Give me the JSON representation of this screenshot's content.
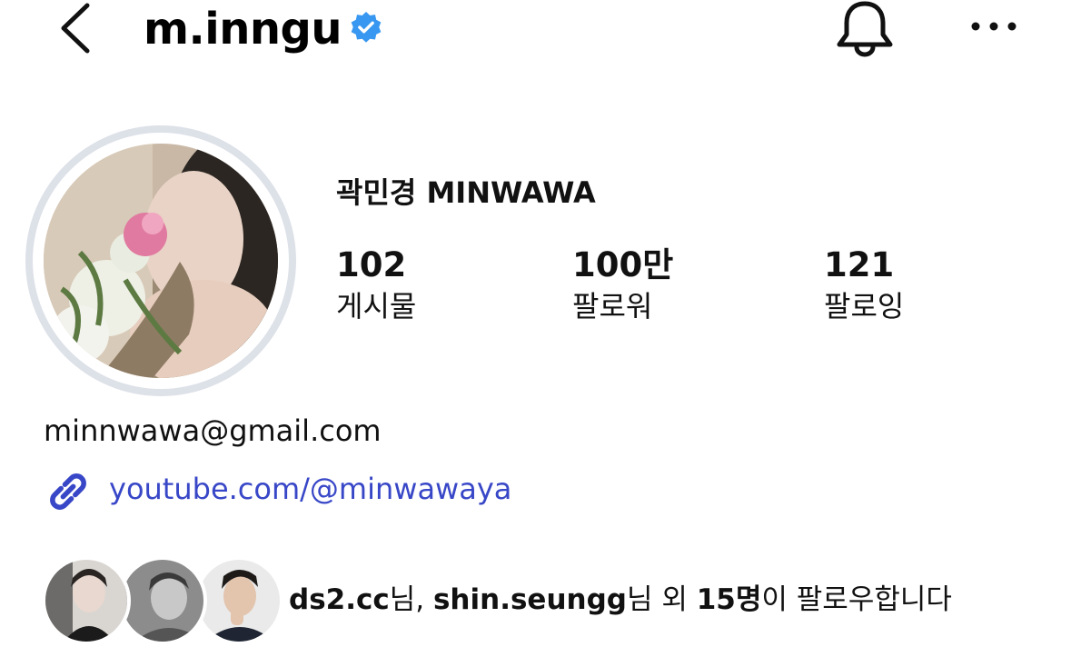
{
  "header": {
    "username": "m.inngu",
    "back_icon": "chevron-left-icon",
    "verified_icon": "verified-badge-icon",
    "notification_icon": "bell-icon",
    "more_icon": "more-horizontal-icon"
  },
  "profile": {
    "full_name": "곽민경 MINWAWA",
    "stats": [
      {
        "value": "102",
        "label": "게시물"
      },
      {
        "value": "100만",
        "label": "팔로워"
      },
      {
        "value": "121",
        "label": "팔로잉"
      }
    ],
    "email": "minnwawa@gmail.com",
    "link": "youtube.com/@minwawaya",
    "link_icon": "link-icon"
  },
  "followed_by": {
    "user1": "ds2.cc",
    "suffix1": "님, ",
    "user2": "shin.seungg",
    "suffix2": "님 외 ",
    "count": "15명",
    "tail": "이 팔로우합니다"
  },
  "colors": {
    "verified_blue": "#3897f0",
    "link_blue": "#3847c7",
    "avatar_ring": "#dde1e8"
  }
}
